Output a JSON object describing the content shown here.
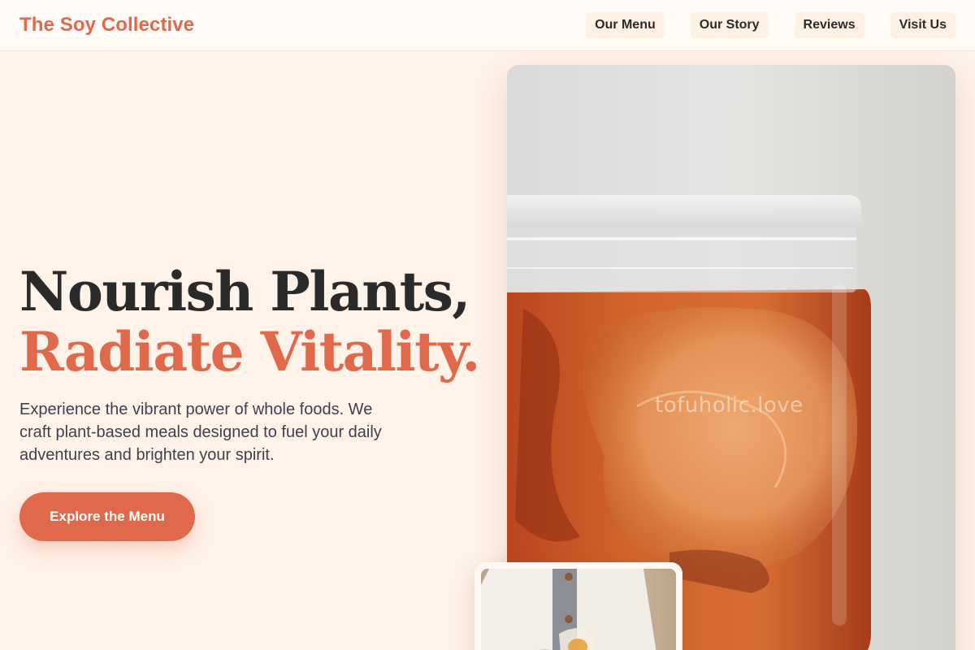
{
  "header": {
    "brand": "The Soy Collective",
    "nav": [
      {
        "label": "Our Menu"
      },
      {
        "label": "Our Story"
      },
      {
        "label": "Reviews"
      },
      {
        "label": "Visit Us"
      }
    ]
  },
  "hero": {
    "title_line1": "Nourish Plants,",
    "title_line2": "Radiate Vitality.",
    "description": "Experience the vibrant power of whole foods. We craft plant-based meals designed to fuel your daily adventures and brighten your spirit.",
    "cta_label": "Explore the Menu",
    "main_image_watermark": "tofuholic.love"
  },
  "colors": {
    "accent": "#e0694c",
    "background": "#fff2e8",
    "header_bg": "#fffaf6",
    "heading_dark": "#2a2a2a",
    "body_text": "#3f4150"
  }
}
